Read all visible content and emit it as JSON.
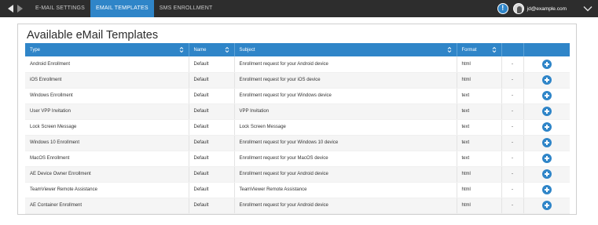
{
  "nav": {
    "back_icon": "arrow-left-icon",
    "forward_icon": "arrow-right-icon"
  },
  "tabs": [
    {
      "label": "E-MAIL SETTINGS",
      "active": false
    },
    {
      "label": "EMAIL TEMPLATES",
      "active": true
    },
    {
      "label": "SMS ENROLLMENT",
      "active": false
    }
  ],
  "user": {
    "email": "jd@example.com",
    "alert_glyph": "!"
  },
  "accent_color": "#2f85c8",
  "page": {
    "title": "Available eMail Templates"
  },
  "table": {
    "columns": [
      {
        "label": "Type",
        "sortable": true
      },
      {
        "label": "Name",
        "sortable": true
      },
      {
        "label": "Subject",
        "sortable": true
      },
      {
        "label": "Format",
        "sortable": true
      },
      {
        "label": "",
        "sortable": false
      },
      {
        "label": "",
        "sortable": false
      }
    ],
    "rows": [
      {
        "type": "Android Enrollment",
        "name": "Default",
        "subject": "Enrollment request for your Android device",
        "format": "html",
        "extra": "-"
      },
      {
        "type": "iOS Enrollment",
        "name": "Default",
        "subject": "Enrollment request for your iOS device",
        "format": "html",
        "extra": "-"
      },
      {
        "type": "Windows Enrollment",
        "name": "Default",
        "subject": "Enrollment request for your Windows device",
        "format": "text",
        "extra": "-"
      },
      {
        "type": "User VPP Invitation",
        "name": "Default",
        "subject": "VPP Invitation",
        "format": "text",
        "extra": "-"
      },
      {
        "type": "Lock Screen Message",
        "name": "Default",
        "subject": "Lock Screen Message",
        "format": "text",
        "extra": "-"
      },
      {
        "type": "Windows 10 Enrollment",
        "name": "Default",
        "subject": "Enrollment request for your Windows 10 device",
        "format": "text",
        "extra": "-"
      },
      {
        "type": "MacOS Enrollment",
        "name": "Default",
        "subject": "Enrollment request for your MacOS device",
        "format": "text",
        "extra": "-"
      },
      {
        "type": "AE Device Owner Enrollment",
        "name": "Default",
        "subject": "Enrollment request for your Android device",
        "format": "html",
        "extra": "-"
      },
      {
        "type": "TeamViewer Remote Assistance",
        "name": "Default",
        "subject": "TeamViewer Remote Assistance",
        "format": "html",
        "extra": "-"
      },
      {
        "type": "AE Container Enrollment",
        "name": "Default",
        "subject": "Enrollment request for your Android device",
        "format": "html",
        "extra": "-"
      }
    ]
  }
}
